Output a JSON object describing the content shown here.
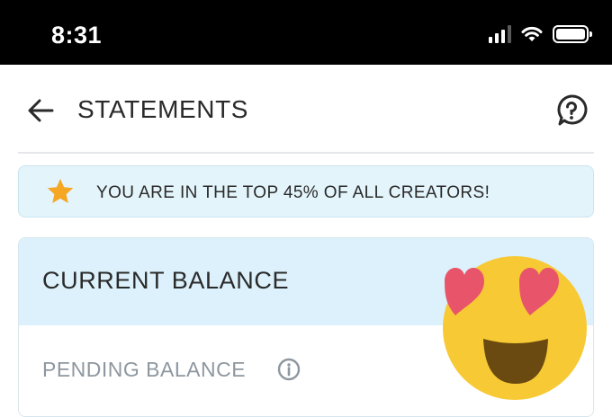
{
  "status_bar": {
    "time": "8:31",
    "icons": [
      "signal-icon",
      "wifi-icon",
      "battery-icon"
    ]
  },
  "header": {
    "title": "STATEMENTS",
    "back_icon": "back-arrow-icon",
    "help_icon": "help-icon"
  },
  "banner": {
    "icon": "star-icon",
    "text": "YOU ARE IN THE TOP 45% OF ALL CREATORS!"
  },
  "balance_card": {
    "title": "CURRENT BALANCE",
    "pending_label": "PENDING BALANCE",
    "info_icon": "info-icon"
  },
  "overlay": {
    "emoji": "heart-eyes-emoji"
  },
  "colors": {
    "status_bar_bg": "#000000",
    "banner_bg": "#e3f4fb",
    "card_header_bg": "#dcf1fb",
    "star": "#f5a623",
    "text_primary": "#2a2a2a",
    "text_muted": "#8e97a0"
  }
}
